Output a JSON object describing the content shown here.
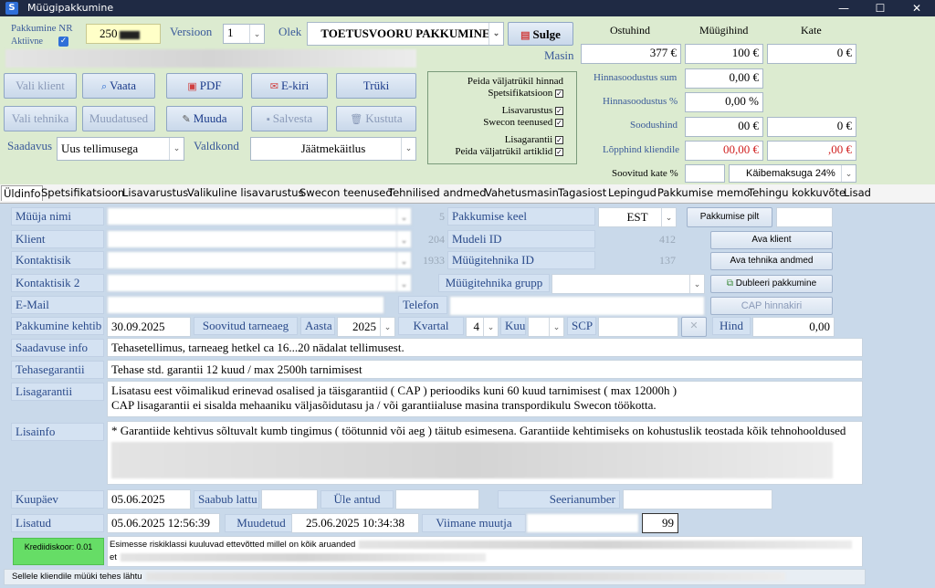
{
  "window": {
    "title": "Müügipakkumine",
    "app_icon": "S",
    "min": "—",
    "max": "☐",
    "close": "✕"
  },
  "header": {
    "pakkumine_nr_label": "Pakkumine NR",
    "aktiivne_label": "Aktiivne",
    "pakkumine_nr_value": "250",
    "versioon_label": "Versioon",
    "versioon_value": "1",
    "olek_label": "Olek",
    "olek_value": "TOETUSVOORU PAKKUMINE",
    "sulge_label": "Sulge",
    "buttons": {
      "vali_klient": "Vali klient",
      "vaata": "Vaata",
      "pdf": "PDF",
      "e_kiri": "E-kiri",
      "tryki": "Trüki",
      "vali_tehnika": "Vali tehnika",
      "muudatused": "Muudatused",
      "muuda": "Muuda",
      "salvesta": "Salvesta",
      "kustuta": "Kustuta"
    },
    "saadavus_label": "Saadavus",
    "saadavus_value": "Uus tellimusega",
    "valdkond_label": "Valdkond",
    "valdkond_value": "Jäätmekäitlus",
    "options": {
      "peida_hinnad": "Peida väljatrükil hinnad",
      "spetsifikatsioon": "Spetsifikatsioon",
      "lisavarustus": "Lisavarustus",
      "swecon_teenused": "Swecon teenused",
      "lisagarantii": "Lisagarantii",
      "peida_artiklid": "Peida väljatrükil artiklid"
    },
    "pricing": {
      "ostuhind_label": "Ostuhind",
      "myygihind_label": "Müügihind",
      "kate_label": "Kate",
      "masin_label": "Masin",
      "masin_ostuhind": "377 €",
      "masin_myygihind": "100 €",
      "masin_kate": "0 €",
      "hinnasoodustus_sum_label": "Hinnasoodustus sum",
      "hinnasoodustus_sum": "0,00 €",
      "hinnasoodustus_pct_label": "Hinnasoodustus %",
      "hinnasoodustus_pct": "0,00 %",
      "soodushind_label": "Soodushind",
      "soodushind": "00 €",
      "soodushind_kate": "0 €",
      "lopphind_label": "Lõpphind kliendile",
      "lopphind": "00,00 €",
      "lopphind_kate": ",00 €",
      "soovitud_kate_label": "Soovitud kate %",
      "kaibemaks_value": "Käibemaksuga 24%"
    }
  },
  "tabs": [
    "Üldinfo",
    "Spetsifikatsioon",
    "Lisavarustus",
    "Valikuline lisavarustus",
    "Swecon teenused",
    "Tehnilised andmed",
    "Vahetusmasin",
    "Tagasiost",
    "Lepingud",
    "Pakkumise memo",
    "Tehingu kokkuvõte",
    "Lisad"
  ],
  "form": {
    "myyja_nimi": "Müüja nimi",
    "myyja_id": "5",
    "pakkumise_keel_label": "Pakkumise keel",
    "pakkumise_keel_value": "EST",
    "pakkumise_pilt": "Pakkumise pilt",
    "klient": "Klient",
    "klient_id": "204",
    "mudeli_id_label": "Mudeli ID",
    "mudeli_id": "412",
    "ava_klient": "Ava klient",
    "kontaktisik": "Kontaktisik",
    "kontaktisik_id": "1933",
    "myygitehnika_id_label": "Müügitehnika ID",
    "myygitehnika_id": "137",
    "ava_tehnika": "Ava tehnika andmed",
    "kontaktisik2": "Kontaktisik 2",
    "myygitehnika_grupp": "Müügitehnika grupp",
    "dubleeri": "Dubleeri pakkumine",
    "email": "E-Mail",
    "telefon": "Telefon",
    "cap_hinnakiri": "CAP hinnakiri",
    "pakkumine_kehtib": "Pakkumine kehtib",
    "kehtib_value": "30.09.2025",
    "soovitud_tarneaeg": "Soovitud tarneaeg",
    "aasta": "Aasta",
    "aasta_value": "2025",
    "kvartal": "Kvartal",
    "kvartal_value": "4",
    "kuu": "Kuu",
    "scp": "SCP",
    "hind": "Hind",
    "hind_value": "0,00",
    "saadavuse_info": "Saadavuse info",
    "saadavuse_info_value": "Tehasetellimus, tarneaeg hetkel ca 16...20 nädalat tellimusest.",
    "tehasegarantii": "Tehasegarantii",
    "tehasegarantii_value": "Tehase std. garantii 12 kuud / max 2500h tarnimisest",
    "lisagarantii": "Lisagarantii",
    "lisagarantii_line1": "Lisatasu eest võimalikud erinevad osalised ja täisgarantiid ( CAP ) perioodiks kuni 60 kuud tarnimisest ( max 12000h )",
    "lisagarantii_line2": "CAP lisagarantii ei sisalda mehaaniku väljasõidutasu ja / või garantiialuse masina transpordikulu Swecon töökotta.",
    "lisainfo": "Lisainfo",
    "lisainfo_value": "* Garantiide kehtivus sõltuvalt kumb tingimus ( töötunnid või aeg ) täitub esimesena. Garantiide kehtimiseks on kohustuslik teostada kõik tehnohooldused",
    "kuupaev": "Kuupäev",
    "kuupaev_value": "05.06.2025",
    "saabub_lattu": "Saabub lattu",
    "yle_antud": "Üle antud",
    "seerianumber": "Seerianumber",
    "lisatud": "Lisatud",
    "lisatud_value": "05.06.2025 12:56:39",
    "muudetud": "Muudetud",
    "muudetud_value": "25.06.2025 10:34:38",
    "viimane_muutja": "Viimane muutja",
    "viimane_muutja_nr": "99",
    "krediidiskoor": "Krediidiskoor: 0.01",
    "risk_text": "Esimesse riskiklassi kuuluvad ettevõtted millel on kõik aruanded",
    "risk_text2": "et",
    "myygi_text": "Sellele kliendile müüki tehes lähtu"
  },
  "colors": {
    "header_bg": "#dcebd0",
    "main_bg": "#c9d9ea",
    "credit_green": "#66dd66",
    "titlebar": "#1f2a44"
  }
}
